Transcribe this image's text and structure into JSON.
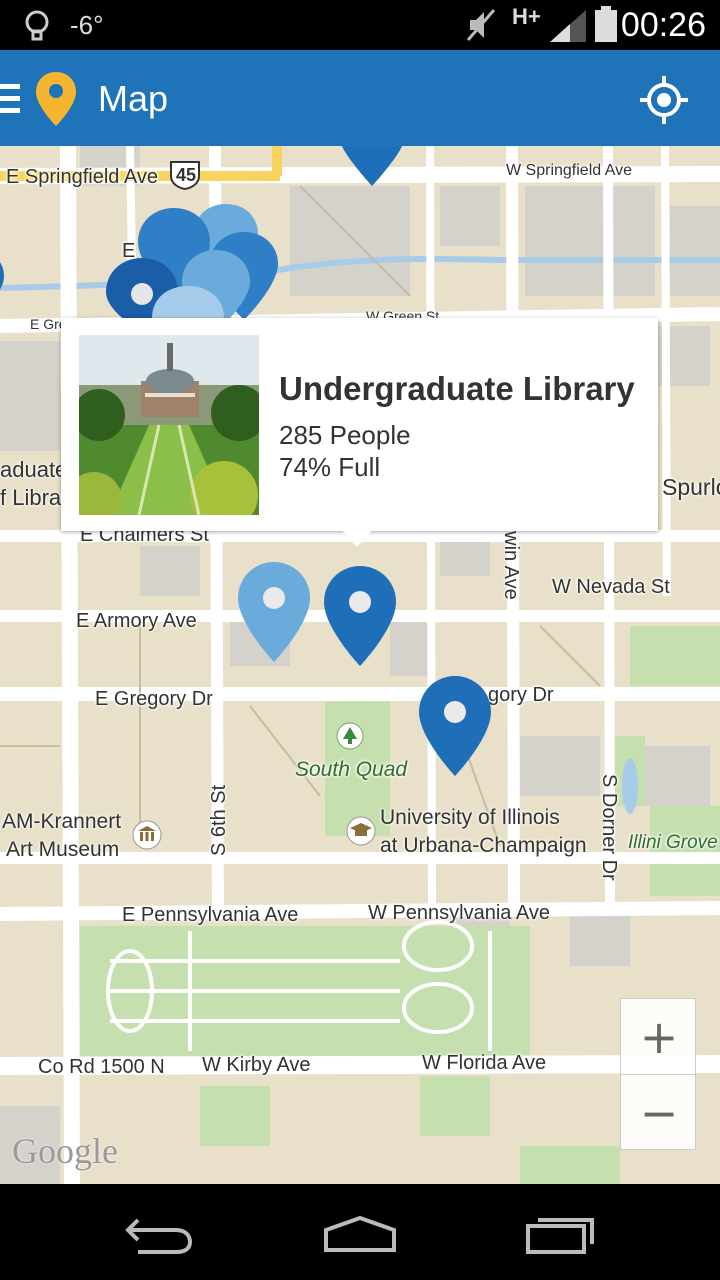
{
  "status_bar": {
    "temperature": "-6°",
    "network": "H+",
    "time": "00:26"
  },
  "app_bar": {
    "title": "Map",
    "accent_color": "#1f73b9",
    "logo_color": "#f5b52e"
  },
  "map": {
    "streets": {
      "e_springfield": "E Springfield Ave",
      "route": "45",
      "w_springfield": "W Springfield Ave",
      "w_green": "W Green St",
      "e_green": "E Gre",
      "e_chalmers": "E Chalmers St",
      "w_nevada": "W Nevada St",
      "e_armory": "E Armory Ave",
      "e_gregory": "E Gregory Dr",
      "w_gregory": "gory Dr",
      "goodwin": "dwin Ave",
      "s_6th": "S 6th St",
      "s_dorner": "S Dorner Dr",
      "e_pennsylvania": "E Pennsylvania Ave",
      "w_pennsylvania": "W Pennsylvania Ave",
      "co_rd": "Co Rd 1500 N",
      "w_kirby": "W Kirby Ave",
      "w_florida": "W Florida Ave",
      "e_fragment": "E",
      "spurlock": "Spurlo"
    },
    "places": {
      "south_quad": "South Quad",
      "uiuc_line1": "University of Illinois",
      "uiuc_line2": "at Urbana-Champaign",
      "museum_line1": "AM-Krannert",
      "museum_line2": "Art Museum",
      "illini_grove": "Illini Grove",
      "ugl_fragment_1": "aduate",
      "ugl_fragment_2": "f Librar"
    },
    "pin_colors": {
      "dark": "#1a5ea8",
      "mid": "#2f7fc7",
      "light": "#6aabdc"
    },
    "attribution": "Google"
  },
  "info_window": {
    "name": "Undergraduate Library",
    "people": "285 People",
    "capacity": "74% Full"
  },
  "zoom": {
    "in_label": "+",
    "out_label": "−"
  }
}
